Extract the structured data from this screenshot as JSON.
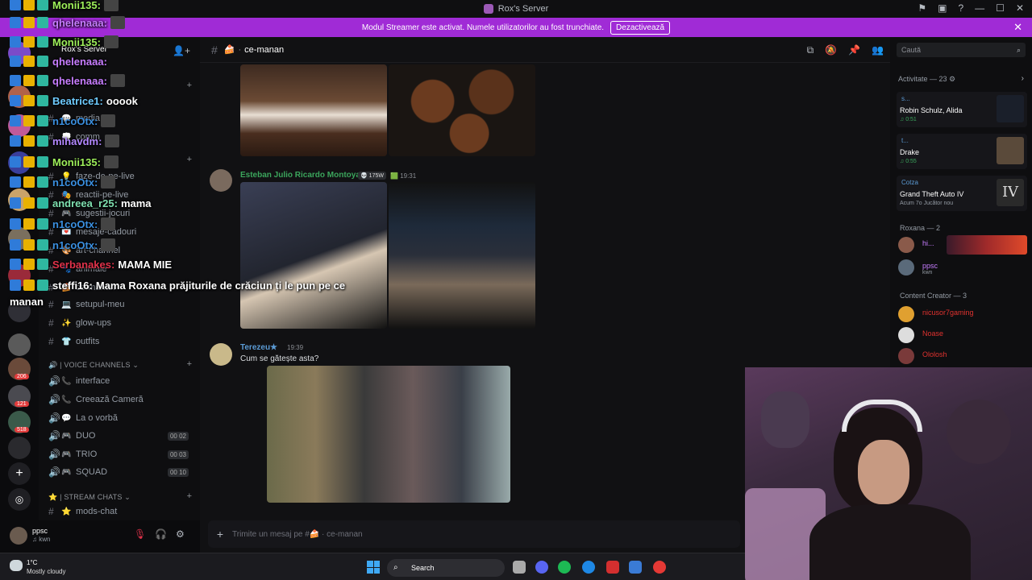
{
  "titlebar": {
    "title": "Rox's Server"
  },
  "banner": {
    "text": "Modul Streamer este activat. Numele utilizatorilor au fost trunchiate.",
    "button": "Dezactivează"
  },
  "server": {
    "name": "Rox's Server"
  },
  "channels": [
    {
      "emoji": "💬",
      "name": "media"
    },
    {
      "emoji": "💭",
      "name": "comm"
    },
    {
      "emoji": "💡",
      "name": "faze-de-pe-live"
    },
    {
      "emoji": "🎭",
      "name": "reactii-pe-live"
    },
    {
      "emoji": "🎮",
      "name": "sugestii-jocuri"
    },
    {
      "emoji": "💌",
      "name": "mesaje-cadouri"
    },
    {
      "emoji": "🎨",
      "name": "art-channel"
    },
    {
      "emoji": "🐾",
      "name": "animale"
    },
    {
      "emoji": "🍰",
      "name": "ce-manan"
    },
    {
      "emoji": "💻",
      "name": "setupul-meu"
    },
    {
      "emoji": "✨",
      "name": "glow-ups"
    },
    {
      "emoji": "👕",
      "name": "outfits"
    }
  ],
  "voice_category": "| VOICE CHANNELS",
  "voice_channels": [
    {
      "emoji": "📞",
      "name": "interface",
      "count": ""
    },
    {
      "emoji": "📞",
      "name": "Creează Cameră",
      "count": ""
    },
    {
      "emoji": "💬",
      "name": "La o vorbă",
      "count": ""
    },
    {
      "emoji": "🎮",
      "name": "DUO",
      "count": "00 02"
    },
    {
      "emoji": "🎮",
      "name": "TRIO",
      "count": "00 03"
    },
    {
      "emoji": "🎮",
      "name": "SQUAD",
      "count": "00 10"
    }
  ],
  "stream_category": "| STREAM CHATS",
  "stream_channels": [
    {
      "emoji": "⭐",
      "name": "mods-chat"
    }
  ],
  "rail_badges": [
    "206",
    "121",
    "518"
  ],
  "user": {
    "name": "ppsc",
    "status": "kwn"
  },
  "channel_header": {
    "name": "ce-manan",
    "emoji": "🍰"
  },
  "messages": [
    {
      "author": "Esteban Julio Ricardo Montoya",
      "tag": "175W",
      "time": "19:31"
    },
    {
      "author": "Terezeu★",
      "time": "19:39",
      "text": "Cum se gătește asta?"
    }
  ],
  "composer": {
    "placeholder": "Trimite un mesaj pe #🍰 · ce-manan"
  },
  "right_panel": {
    "search_placeholder": "Caută",
    "activity_header": "Activitate — 23",
    "cards": [
      {
        "user": "s...",
        "title": "Robin Schulz, Alida",
        "sub": "♫ 0:51"
      },
      {
        "user": "t...",
        "title": "Drake",
        "sub": "♫ 0:55"
      },
      {
        "user": "Cotza",
        "title": "Grand Theft Auto IV",
        "sub": "Acum 7o  Jucător nou"
      }
    ],
    "roxana_header": "Roxana — 2",
    "roxana_members": [
      {
        "name": "hi...",
        "sub": ""
      },
      {
        "name": "ppsc",
        "sub": "kwn"
      }
    ],
    "creator_header": "Content Creator — 3",
    "creator_members": [
      {
        "name": "nicusor7gaming"
      },
      {
        "name": "Noase"
      },
      {
        "name": "Ololosh"
      }
    ]
  },
  "chat_overlay": [
    {
      "name": "Monii135:",
      "msg": "",
      "color": "#9ef05a",
      "emote": true
    },
    {
      "name": "qhelenaaa:",
      "msg": "",
      "color": "#c77dff",
      "emote": true
    },
    {
      "name": "Monii135:",
      "msg": "",
      "color": "#9ef05a",
      "emote": true
    },
    {
      "name": "qhelenaaa:",
      "msg": "",
      "color": "#c77dff",
      "emote": false
    },
    {
      "name": "qhelenaaa:",
      "msg": "",
      "color": "#c77dff",
      "emote": true
    },
    {
      "name": "Beatrice1:",
      "msg": "ooook",
      "color": "#6ecbff",
      "emote": false
    },
    {
      "name": "n1coOtx:",
      "msg": "",
      "color": "#3a8fe0",
      "emote": true
    },
    {
      "name": "mihavdm:",
      "msg": "",
      "color": "#b388ff",
      "emote": true
    },
    {
      "name": "Monii135:",
      "msg": "",
      "color": "#9ef05a",
      "emote": true
    },
    {
      "name": "n1coOtx:",
      "msg": "",
      "color": "#3a8fe0",
      "emote": true
    },
    {
      "name": "andreea_r25:",
      "msg": "mama",
      "color": "#7fe0b0",
      "emote": false
    },
    {
      "name": "n1coOtx:",
      "msg": "",
      "color": "#3a8fe0",
      "emote": true
    },
    {
      "name": "n1coOtx:",
      "msg": "",
      "color": "#3a8fe0",
      "emote": true
    },
    {
      "name": "Serbanakes:",
      "msg": "MAMA MIE",
      "color": "#e0324a",
      "emote": false
    },
    {
      "name": "steffi16:",
      "msg": "Mama Roxana prăjiturile de crăciun ți le pun pe ce",
      "color": "#ffffff",
      "emote": false
    }
  ],
  "chat_overlay_wrap": "manan",
  "taskbar": {
    "temp": "1°C",
    "weather": "Mostly cloudy",
    "search": "Search"
  }
}
